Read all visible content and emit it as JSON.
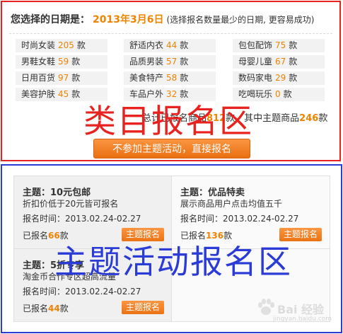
{
  "date_header": {
    "label": "您选择的日期是：",
    "date": "2013年3月6日",
    "hint": "(选择报名数量最少的日期, 更容易成功)"
  },
  "unit": "款",
  "categories": [
    {
      "name": "时尚女装",
      "count": "205"
    },
    {
      "name": "舒适内衣",
      "count": "44"
    },
    {
      "name": "包包配饰",
      "count": "75"
    },
    {
      "name": "男鞋女鞋",
      "count": "59"
    },
    {
      "name": "品质男装",
      "count": "57"
    },
    {
      "name": "母婴儿童",
      "count": "67"
    },
    {
      "name": "日用百货",
      "count": "97"
    },
    {
      "name": "美食特产",
      "count": "58"
    },
    {
      "name": "数码家电",
      "count": "29"
    },
    {
      "name": "美容护肤",
      "count": "45"
    },
    {
      "name": "车品户外",
      "count": "32"
    },
    {
      "name": "吃喝玩乐",
      "count": "0"
    }
  ],
  "totals": {
    "prefix": "总计已报名商品",
    "total": "812",
    "mid": "款，其中主题商品",
    "theme": "246",
    "suffix": "款"
  },
  "direct_button": "不参加主题活动，直接报名",
  "overlay_category": "类目报名区",
  "overlay_theme": "主题活动报名区",
  "themes": [
    {
      "title": "主题：10元包邮",
      "desc": "折扣价低于20元皆可报名",
      "time_label": "报名时间：",
      "time": "2013.02.24-02.27",
      "signed_label": "已报名",
      "signed": "66",
      "signed_unit": "款",
      "button": "主题报名"
    },
    {
      "title": "主题：优品特卖",
      "desc": "展示商品用户点击均值五千",
      "time_label": "报名时间：",
      "time": "2013.02.24-02.27",
      "signed_label": "已报名",
      "signed": "136",
      "signed_unit": "款",
      "button": "主题报名"
    },
    {
      "title": "主题：5折专享",
      "desc": "淘金币合作专区超高流量",
      "time_label": "报名时间：",
      "time": "2013.02.24-02.27",
      "signed_label": "已报名",
      "signed": "44",
      "signed_unit": "款",
      "button": "主题报名"
    }
  ],
  "watermark": {
    "text": "Bai 经验",
    "sub": "jingyan.baidu.com"
  },
  "colors": {
    "accent": "#f08300",
    "category_border": "#e8231f",
    "theme_border": "#2b3bd6"
  }
}
